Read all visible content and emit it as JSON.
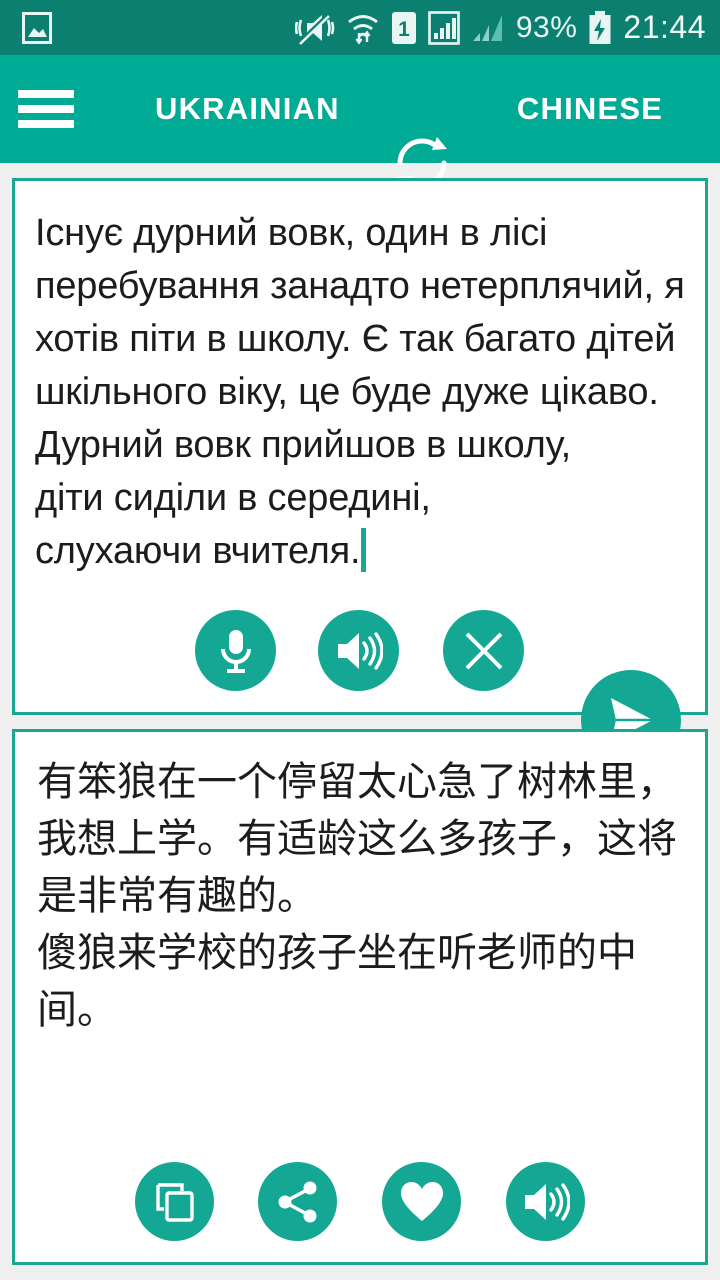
{
  "status_bar": {
    "background": "#0b8070",
    "left_icon": "image-gallery-icon",
    "icons": [
      "vibrate-mute-icon",
      "wifi-icon",
      "sim1-icon",
      "signal-bars-icon",
      "signal-bars-secondary-icon"
    ],
    "battery_percent": "93%",
    "battery_state": "charging",
    "clock": "21:44"
  },
  "app_bar": {
    "background": "#00ab95",
    "menu_icon": "hamburger-menu-icon",
    "source_language": "UKRAINIAN",
    "swap_icon": "swap-languages-icon",
    "target_language": "CHINESE"
  },
  "source_card": {
    "border_color": "#19a794",
    "text": "Існує дурний вовк, один в лісі перебування занадто нетерплячий, я хотів піти в школу. Є так багато дітей шкільного віку, це буде дуже цікаво.\nДурний вовк прийшов в школу,\nдіти сиділи в середині,\nслухаючи вчителя.",
    "caret_visible": true,
    "buttons": [
      {
        "name": "microphone-button",
        "icon": "microphone-icon",
        "label": "Voice input"
      },
      {
        "name": "speak-source-button",
        "icon": "speaker-icon",
        "label": "Speak source"
      },
      {
        "name": "clear-button",
        "icon": "close-icon",
        "label": "Clear text"
      }
    ]
  },
  "send_button": {
    "name": "send-button",
    "icon": "send-paper-plane-icon",
    "label": "Translate",
    "color": "#13a794"
  },
  "target_card": {
    "border_color": "#19a794",
    "text": "有笨狼在一个停留太心急了树林里，我想上学。有适龄这么多孩子，这将是非常有趣的。\n傻狼来学校的孩子坐在听老师的中间。",
    "buttons": [
      {
        "name": "copy-button",
        "icon": "copy-icon",
        "label": "Copy"
      },
      {
        "name": "share-button",
        "icon": "share-icon",
        "label": "Share"
      },
      {
        "name": "favorite-button",
        "icon": "heart-icon",
        "label": "Favorite"
      },
      {
        "name": "speak-target-button",
        "icon": "speaker-icon",
        "label": "Speak translation"
      }
    ]
  },
  "theme": {
    "accent": "#00ab95",
    "accent_dark": "#0b8070",
    "button": "#13a794",
    "page_background": "#efefef",
    "card_background": "#ffffff",
    "text_color": "#1c1c1c"
  }
}
